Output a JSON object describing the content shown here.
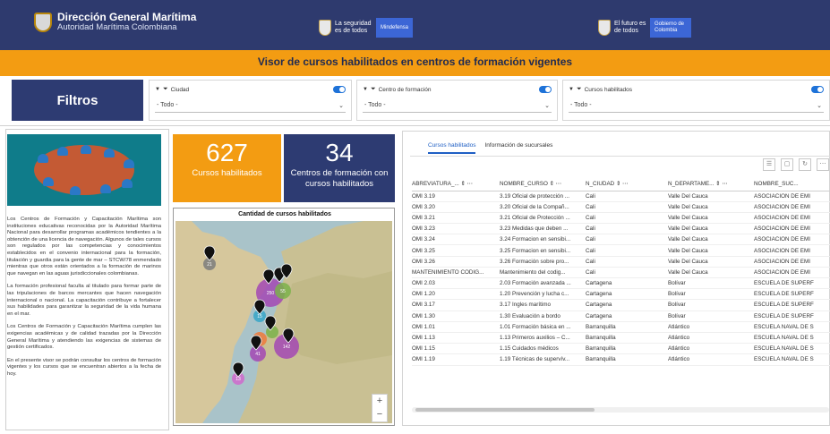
{
  "header": {
    "brand_title": "Dirección General Marítima",
    "brand_sub": "Autoridad Marítima Colombiana",
    "logo1_text": "La seguridad es de todos",
    "logo1_box": "Mindefensa",
    "logo2_text": "El futuro es de todos",
    "logo2_box": "Gobierno de Colombia"
  },
  "page_title": "Visor de cursos habilitados en centros de formación vigentes",
  "filters": {
    "label": "Filtros",
    "items": [
      {
        "label": "Ciudad",
        "value": "- Todo -"
      },
      {
        "label": "Centro de formación",
        "value": "- Todo -"
      },
      {
        "label": "Cursos habilitados",
        "value": "- Todo -"
      }
    ]
  },
  "description": [
    "Los Centros de Formación y Capacitación Marítima son instituciones educativas reconocidas por la Autoridad Marítima Nacional para desarrollar programas académicos tendientes a la obtención de una licencia de navegación. Algunos de tales cursos son regulados por las competencias y conocimientos establecidos en el convenio internacional para la formación, titulación y guardia para la gente de mar – STCW/78 enmendado mientras que otros están orientados a la formación de marinos que navegan en las aguas jurisdiccionales colombianas.",
    "La formación profesional faculta al titulado para formar parte de las tripulaciones de barcos mercantes que hacen navegación internacional o nacional. La capacitación contribuye a fortalecer sus habilidades para garantizar la seguridad de la vida humana en el mar.",
    "Los Centros de Formación y Capacitación Marítima cumplen las exigencias académicas y de calidad trazadas por la Dirección General Marítima y atendiendo las exigencias de sistemas de gestión certificados.",
    "En el presente visor se podrán consultar los centros de formación vigentes y los cursos que se encuentran abiertos a la fecha de hoy."
  ],
  "kpis": {
    "cursos": {
      "value": "627",
      "label": "Cursos habilitados",
      "color": "#f39c12"
    },
    "centros": {
      "value": "34",
      "label": "Centros de formación con cursos habilitados",
      "color": "#2d3b72"
    }
  },
  "map": {
    "title": "Cantidad de cursos habilitados",
    "clusters": [
      "21",
      "250",
      "15",
      "55",
      "142",
      "41",
      "13"
    ]
  },
  "table": {
    "tabs": [
      "Cursos habilitados",
      "Información de sucursales"
    ],
    "columns": [
      "ABREVIATURA_...",
      "NOMBRE_CURSO",
      "N_CIUDAD",
      "N_DEPARTAME...",
      "NOMBRE_SUC..."
    ],
    "rows": [
      [
        "OMI 3.19",
        "3.19 Oficial de protección ...",
        "Cali",
        "Valle Del Cauca",
        "ASOCIACION DE EMI"
      ],
      [
        "OMI 3.20",
        "3.20 Oficial de la Compañ...",
        "Cali",
        "Valle Del Cauca",
        "ASOCIACION DE EMI"
      ],
      [
        "OMI 3.21",
        "3.21 Oficial de Protección ...",
        "Cali",
        "Valle Del Cauca",
        "ASOCIACION DE EMI"
      ],
      [
        "OMI 3.23",
        "3.23 Medidas que deben ...",
        "Cali",
        "Valle Del Cauca",
        "ASOCIACION DE EMI"
      ],
      [
        "OMI 3.24",
        "3.24 Formacion en sensibi...",
        "Cali",
        "Valle Del Cauca",
        "ASOCIACION DE EMI"
      ],
      [
        "OMI 3.25",
        "3.25 Formacion en sensibi...",
        "Cali",
        "Valle Del Cauca",
        "ASOCIACION DE EMI"
      ],
      [
        "OMI 3.26",
        "3.26 Formación sobre pro...",
        "Cali",
        "Valle Del Cauca",
        "ASOCIACION DE EMI"
      ],
      [
        "MANTENIMIENTO CODIG...",
        "Mantenimiento del codig...",
        "Cali",
        "Valle Del Cauca",
        "ASOCIACION DE EMI"
      ],
      [
        "OMI 2.03",
        "2.03 Formación avanzada ...",
        "Cartagena",
        "Bolívar",
        "ESCUELA DE SUPERF"
      ],
      [
        "OMI 1.20",
        "1.20 Prevención y lucha c...",
        "Cartagena",
        "Bolívar",
        "ESCUELA DE SUPERF"
      ],
      [
        "OMI 3.17",
        "3.17 Ingles marítimo",
        "Cartagena",
        "Bolívar",
        "ESCUELA DE SUPERF"
      ],
      [
        "OMI 1.30",
        "1.30 Evaluación a bordo",
        "Cartagena",
        "Bolívar",
        "ESCUELA DE SUPERF"
      ],
      [
        "OMI 1.01",
        "1.01 Formación básica en ...",
        "Barranquilla",
        "Atlántico",
        "ESCUELA NAVAL DE S"
      ],
      [
        "OMI 1.13",
        "1.13 Primeros auxilios – C...",
        "Barranquilla",
        "Atlántico",
        "ESCUELA NAVAL DE S"
      ],
      [
        "OMI 1.15",
        "1.15 Cuidados médicos",
        "Barranquilla",
        "Atlántico",
        "ESCUELA NAVAL DE S"
      ],
      [
        "OMI 1.19",
        "1.19 Técnicas de supervív...",
        "Barranquilla",
        "Atlántico",
        "ESCUELA NAVAL DE S"
      ]
    ]
  }
}
